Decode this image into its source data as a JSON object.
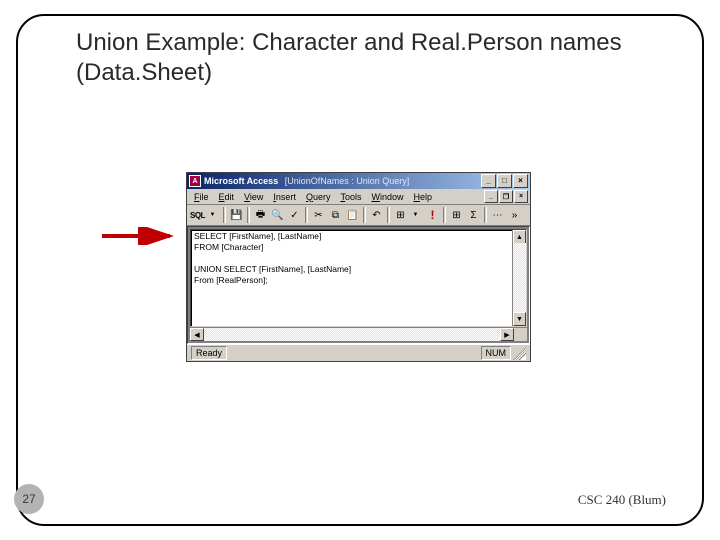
{
  "slide": {
    "title": "Union Example: Character and Real.Person names (Data.Sheet)",
    "page_number": "27",
    "footer": "CSC 240 (Blum)"
  },
  "window": {
    "app_name": "Microsoft Access",
    "doc_name": "[UnionOfNames : Union Query]",
    "icon_glyph": "A",
    "controls": {
      "min": "_",
      "max": "□",
      "close": "×"
    },
    "child_controls": {
      "min": "_",
      "restore": "❐",
      "close": "×"
    }
  },
  "menu": {
    "items": [
      {
        "k": "F",
        "rest": "ile"
      },
      {
        "k": "E",
        "rest": "dit"
      },
      {
        "k": "V",
        "rest": "iew"
      },
      {
        "k": "I",
        "rest": "nsert"
      },
      {
        "k": "Q",
        "rest": "uery"
      },
      {
        "k": "T",
        "rest": "ools"
      },
      {
        "k": "W",
        "rest": "indow"
      },
      {
        "k": "H",
        "rest": "elp"
      }
    ]
  },
  "toolbar": {
    "sql_view": "SQL",
    "save_icon": "💾",
    "print_icon": "🖶",
    "preview_icon": "🔍",
    "spell_icon": "✓",
    "cut_icon": "✂",
    "copy_icon": "⧉",
    "paste_icon": "📋",
    "undo_icon": "↶",
    "querytype_icon": "⊞",
    "run_icon": "!",
    "show_icon": "⊞",
    "totals_icon": "Σ",
    "more1_icon": "⋯",
    "more2_icon": "»"
  },
  "sql": {
    "line1": "SELECT [FirstName], [LastName]",
    "line2": "FROM [Character]",
    "line3": "",
    "line4": "UNION SELECT [FirstName], [LastName]",
    "line5": "From [RealPerson];"
  },
  "scroll": {
    "up": "▲",
    "down": "▼",
    "left": "◀",
    "right": "▶"
  },
  "status": {
    "ready": "Ready",
    "num": "NUM"
  }
}
